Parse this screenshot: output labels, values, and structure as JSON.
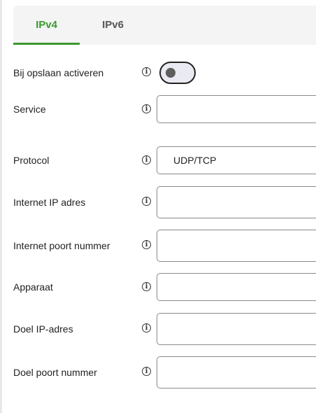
{
  "tabs": [
    {
      "label": "IPv4",
      "active": true
    },
    {
      "label": "IPv6",
      "active": false
    }
  ],
  "accent_color": "#3a9a2e",
  "info_icon": "info-icon",
  "form": {
    "enable_on_save": {
      "label": "Bij opslaan activeren",
      "value": false
    },
    "service": {
      "label": "Service",
      "value": ""
    },
    "protocol": {
      "label": "Protocol",
      "value": "UDP/TCP"
    },
    "internet_ip": {
      "label": "Internet IP adres",
      "value": ""
    },
    "internet_port": {
      "label": "Internet poort nummer",
      "value": ""
    },
    "device": {
      "label": "Apparaat",
      "value": ""
    },
    "target_ip": {
      "label": "Doel IP-adres",
      "value": ""
    },
    "target_port": {
      "label": "Doel poort nummer",
      "value": ""
    }
  }
}
